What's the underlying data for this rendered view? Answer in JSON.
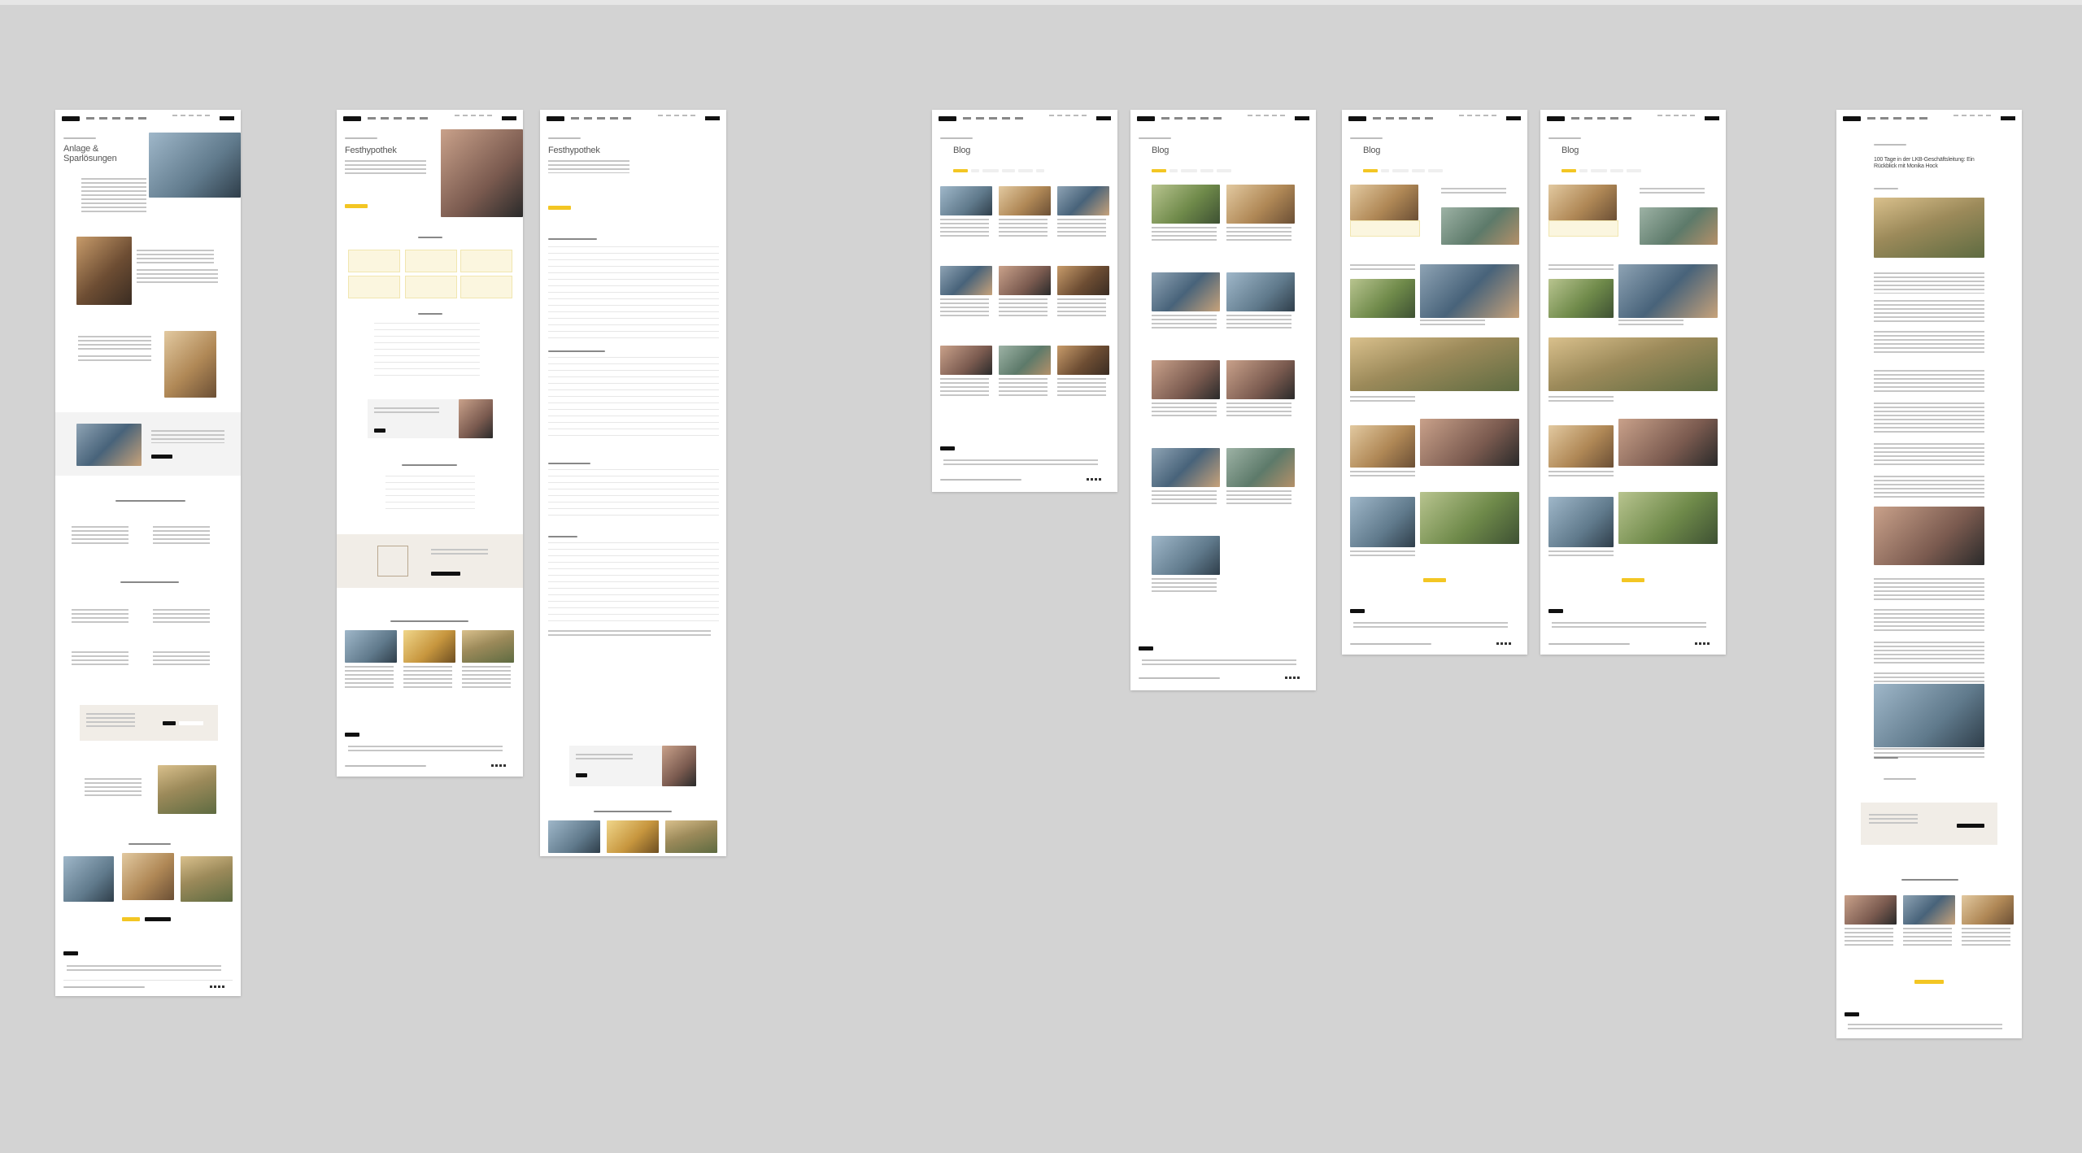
{
  "canvas": {
    "background": "#d3d3d3",
    "accent": "#f3c623",
    "dark": "#111111"
  },
  "pages": [
    {
      "id": "anlage",
      "title_line1": "Anlage &",
      "title_line2": "Sparlösungen"
    },
    {
      "id": "festhypothek-a",
      "title": "Festhypothek"
    },
    {
      "id": "festhypothek-b",
      "title": "Festhypothek"
    },
    {
      "id": "blog-1",
      "title": "Blog"
    },
    {
      "id": "blog-2",
      "title": "Blog"
    },
    {
      "id": "blog-3",
      "title": "Blog"
    },
    {
      "id": "blog-4",
      "title": "Blog"
    },
    {
      "id": "article",
      "title": "100 Tage in der LKB-Geschäftsleitung: Ein Rückblick mit Monika Hock"
    }
  ]
}
